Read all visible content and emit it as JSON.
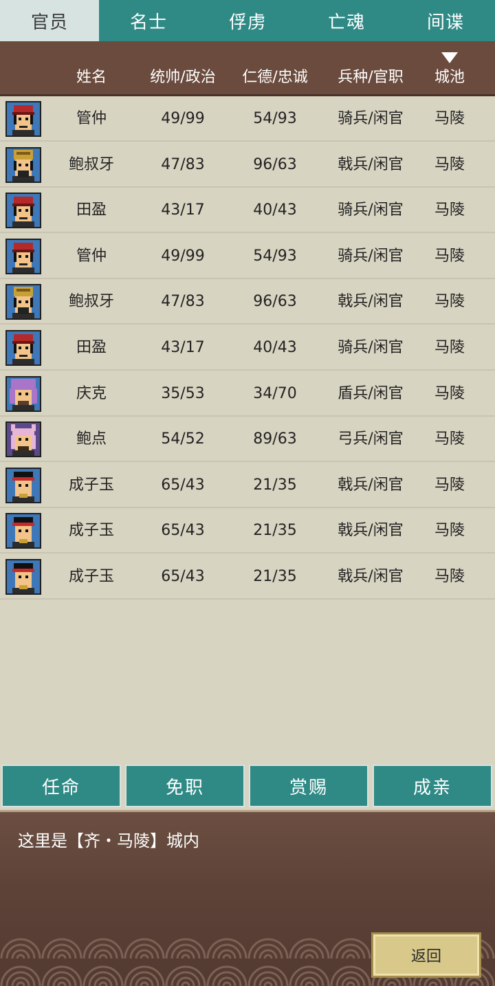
{
  "tabs": [
    {
      "label": "官员",
      "active": true
    },
    {
      "label": "名士",
      "active": false
    },
    {
      "label": "俘虏",
      "active": false
    },
    {
      "label": "亡魂",
      "active": false
    },
    {
      "label": "间谍",
      "active": false
    }
  ],
  "columns": {
    "name": "姓名",
    "leadership_politics": "统帅/政治",
    "virtue_loyalty": "仁德/忠诚",
    "troop_office": "兵种/官职",
    "city": "城池"
  },
  "sort_icon": "triangle-down-icon",
  "officers": [
    {
      "name": "管仲",
      "lp": "49/99",
      "vl": "54/93",
      "troop": "骑兵/闲官",
      "city": "马陵",
      "avatar": "red-hat"
    },
    {
      "name": "鲍叔牙",
      "lp": "47/83",
      "vl": "96/63",
      "troop": "戟兵/闲官",
      "city": "马陵",
      "avatar": "gold-crown"
    },
    {
      "name": "田盈",
      "lp": "43/17",
      "vl": "40/43",
      "troop": "骑兵/闲官",
      "city": "马陵",
      "avatar": "red-hat"
    },
    {
      "name": "管仲",
      "lp": "49/99",
      "vl": "54/93",
      "troop": "骑兵/闲官",
      "city": "马陵",
      "avatar": "red-hat"
    },
    {
      "name": "鲍叔牙",
      "lp": "47/83",
      "vl": "96/63",
      "troop": "戟兵/闲官",
      "city": "马陵",
      "avatar": "gold-crown"
    },
    {
      "name": "田盈",
      "lp": "43/17",
      "vl": "40/43",
      "troop": "骑兵/闲官",
      "city": "马陵",
      "avatar": "red-hat"
    },
    {
      "name": "庆克",
      "lp": "35/53",
      "vl": "34/70",
      "troop": "盾兵/闲官",
      "city": "马陵",
      "avatar": "purple-hair"
    },
    {
      "name": "鲍点",
      "lp": "54/52",
      "vl": "89/63",
      "troop": "弓兵/闲官",
      "city": "马陵",
      "avatar": "pink-horns"
    },
    {
      "name": "成子玉",
      "lp": "65/43",
      "vl": "21/35",
      "troop": "戟兵/闲官",
      "city": "马陵",
      "avatar": "red-band"
    },
    {
      "name": "成子玉",
      "lp": "65/43",
      "vl": "21/35",
      "troop": "戟兵/闲官",
      "city": "马陵",
      "avatar": "red-band"
    },
    {
      "name": "成子玉",
      "lp": "65/43",
      "vl": "21/35",
      "troop": "戟兵/闲官",
      "city": "马陵",
      "avatar": "red-band"
    }
  ],
  "actions": [
    {
      "label": "任命",
      "name": "appoint-button"
    },
    {
      "label": "免职",
      "name": "dismiss-button"
    },
    {
      "label": "赏赐",
      "name": "reward-button"
    },
    {
      "label": "成亲",
      "name": "marry-button"
    }
  ],
  "status_text": "这里是【齐・马陵】城内",
  "back_label": "返回",
  "colors": {
    "tab_bg": "#2f8a86",
    "tab_active_bg": "#d6e3e0",
    "header_bg": "#6b4b3e",
    "table_bg": "#d8d4c2",
    "button_bg": "#2f8a86",
    "back_button_bg": "#d8c88a"
  }
}
